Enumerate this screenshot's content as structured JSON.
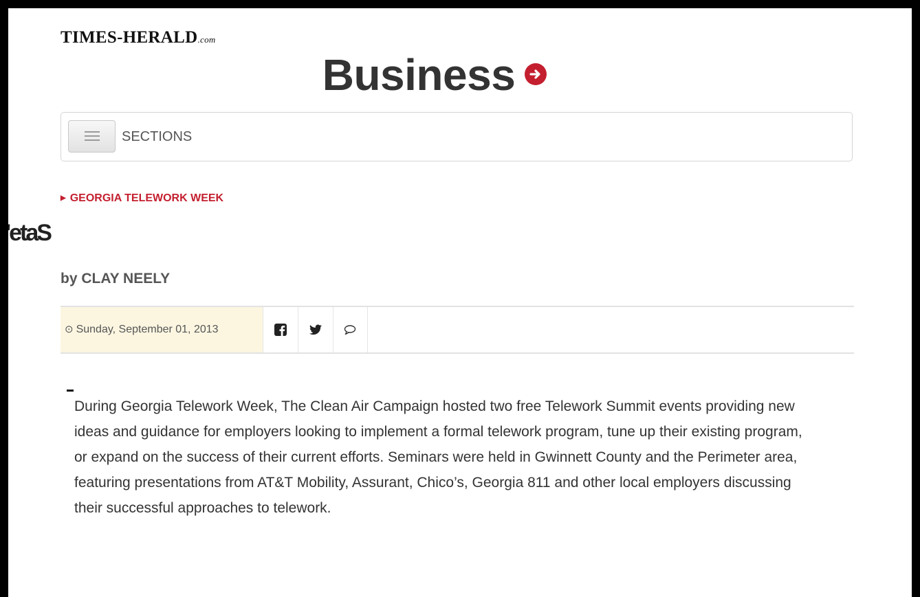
{
  "site": {
    "logo": "TIMES-HERALD",
    "logo_suffix": ".com"
  },
  "section": {
    "title": "Business",
    "icon": "arrow-right-circle-icon",
    "accent_color": "#c41f2f"
  },
  "nav": {
    "menu_icon": "hamburger-icon",
    "sections_label": "SECTIONS"
  },
  "article": {
    "kicker": "GEORGIA TELEWORK WEEK",
    "headline": "'etaS",
    "byline": "by CLAY NEELY",
    "date": "Sunday, September 01, 2013",
    "share": {
      "facebook_icon": "facebook-icon",
      "twitter_icon": "twitter-icon",
      "comment_icon": "comment-icon"
    },
    "body": "During Georgia Telework Week, The Clean Air Campaign hosted two free Telework Summit events providing new ideas and guidance for employers looking to implement a formal telework program, tune up their existing program, or expand on the success of their current efforts. Seminars were held in Gwinnett County and the Perimeter area, featuring presentations from AT&T Mobility, Assurant, Chico’s, Georgia 811 and other local employers discussing their successful approaches to telework."
  }
}
